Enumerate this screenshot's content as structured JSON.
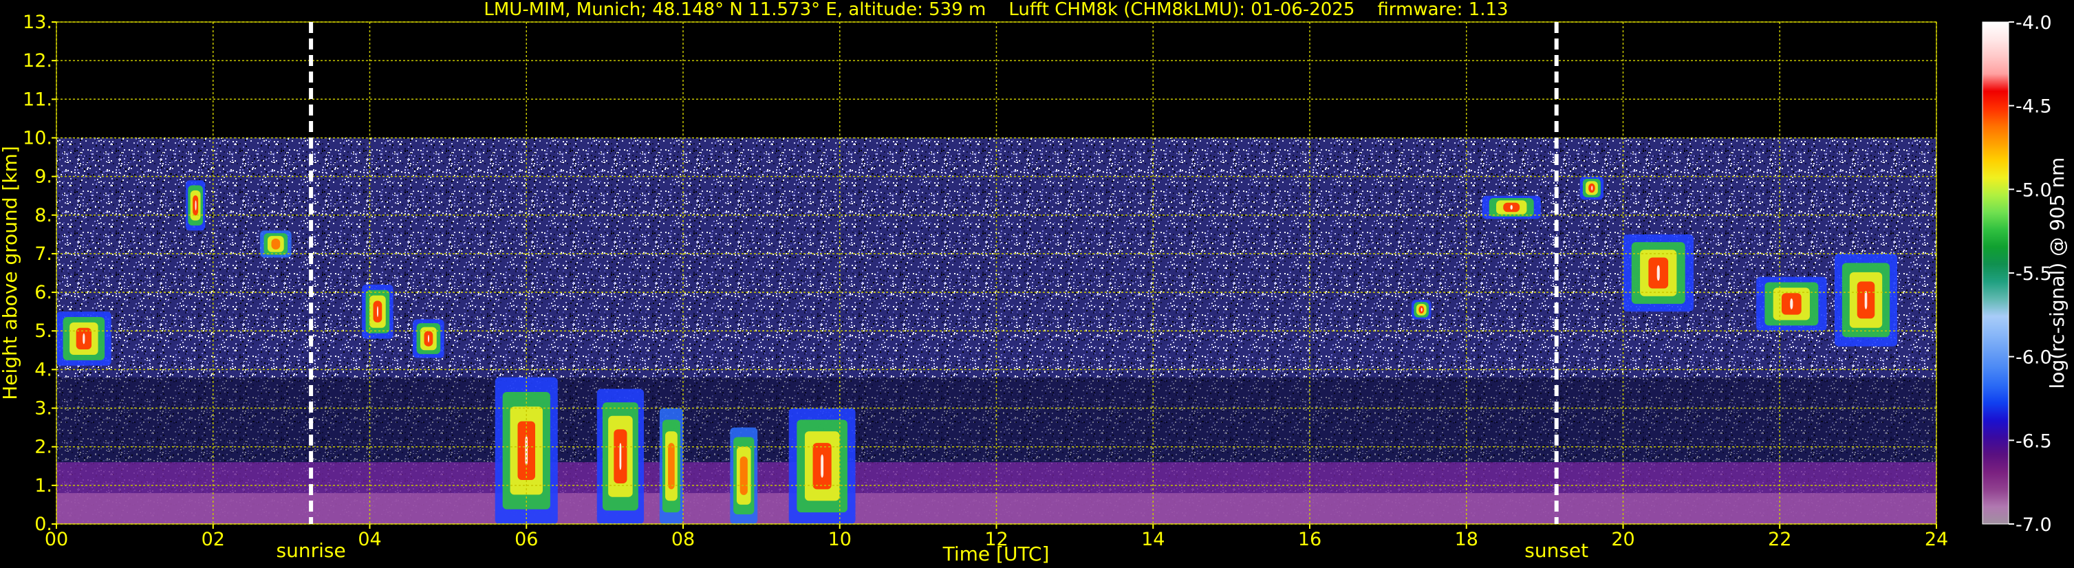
{
  "chart_data": {
    "type": "heatmap",
    "title": "LMU-MIM, Munich; 48.148° N 11.573° E, altitude: 539 m    Lufft CHM8k (CHM8kLMU): 01-06-2025    firmware: 1.13",
    "xlabel": "Time [UTC]",
    "ylabel": "Height above ground [km]",
    "xlim": [
      0,
      24
    ],
    "ylim": [
      0,
      13
    ],
    "x_ticks": [
      "00",
      "02",
      "04",
      "06",
      "08",
      "10",
      "12",
      "14",
      "16",
      "18",
      "20",
      "22",
      "24"
    ],
    "y_ticks": [
      "0.",
      "1.",
      "2.",
      "3.",
      "4.",
      "5.",
      "6.",
      "7.",
      "8.",
      "9.",
      "10.",
      "11.",
      "12.",
      "13."
    ],
    "grid": true,
    "data_top_km": 10,
    "annotations": [
      {
        "label": "sunrise",
        "time_utc": 3.25
      },
      {
        "label": "sunset",
        "time_utc": 19.15
      }
    ],
    "colorbar": {
      "label": "log(rc-signal) @ 905 nm",
      "range": [
        -7.0,
        -4.0
      ],
      "ticks": [
        "-4.0",
        "-4.5",
        "-5.0",
        "-5.5",
        "-6.0",
        "-6.5",
        "-7.0"
      ],
      "colors": [
        "#a090a0",
        "#b078b0",
        "#90408f",
        "#7a2080",
        "#5a1080",
        "#3a0aa0",
        "#1a10d0",
        "#1040f0",
        "#2a6af5",
        "#4a88f5",
        "#6aa0f5",
        "#8ab8f8",
        "#a8ccf8",
        "#60b8b0",
        "#20a080",
        "#109050",
        "#10a030",
        "#30c040",
        "#70e050",
        "#b0f040",
        "#f0f020",
        "#ffd000",
        "#ffa000",
        "#ff7000",
        "#ff3000",
        "#f00000",
        "#ffa0a0",
        "#ffc8c8",
        "#ffe8e8",
        "#ffffff"
      ]
    },
    "cloud_features": [
      {
        "t0": 0.0,
        "t1": 0.7,
        "h0": 4.1,
        "h1": 5.5,
        "intensity": "high"
      },
      {
        "t0": 1.65,
        "t1": 1.9,
        "h0": 7.6,
        "h1": 8.9,
        "intensity": "high"
      },
      {
        "t0": 2.6,
        "t1": 3.0,
        "h0": 6.9,
        "h1": 7.6,
        "intensity": "medium"
      },
      {
        "t0": 3.9,
        "t1": 4.3,
        "h0": 4.8,
        "h1": 6.2,
        "intensity": "high"
      },
      {
        "t0": 4.55,
        "t1": 4.95,
        "h0": 4.3,
        "h1": 5.3,
        "intensity": "high"
      },
      {
        "t0": 5.6,
        "t1": 6.4,
        "h0": 0.0,
        "h1": 3.8,
        "intensity": "high"
      },
      {
        "t0": 6.9,
        "t1": 7.5,
        "h0": 0.0,
        "h1": 3.5,
        "intensity": "high"
      },
      {
        "t0": 7.7,
        "t1": 8.0,
        "h0": 0.0,
        "h1": 3.0,
        "intensity": "medium"
      },
      {
        "t0": 8.6,
        "t1": 8.95,
        "h0": 0.0,
        "h1": 2.5,
        "intensity": "medium"
      },
      {
        "t0": 9.35,
        "t1": 10.2,
        "h0": 0.0,
        "h1": 3.0,
        "intensity": "high"
      },
      {
        "t0": 17.3,
        "t1": 17.55,
        "h0": 5.3,
        "h1": 5.8,
        "intensity": "high"
      },
      {
        "t0": 18.2,
        "t1": 18.95,
        "h0": 7.9,
        "h1": 8.5,
        "intensity": "high"
      },
      {
        "t0": 19.45,
        "t1": 19.75,
        "h0": 8.4,
        "h1": 9.0,
        "intensity": "high"
      },
      {
        "t0": 20.0,
        "t1": 20.9,
        "h0": 5.5,
        "h1": 7.5,
        "intensity": "high"
      },
      {
        "t0": 21.7,
        "t1": 22.6,
        "h0": 5.0,
        "h1": 6.4,
        "intensity": "high"
      },
      {
        "t0": 22.7,
        "t1": 23.5,
        "h0": 4.6,
        "h1": 7.0,
        "intensity": "high"
      }
    ]
  }
}
